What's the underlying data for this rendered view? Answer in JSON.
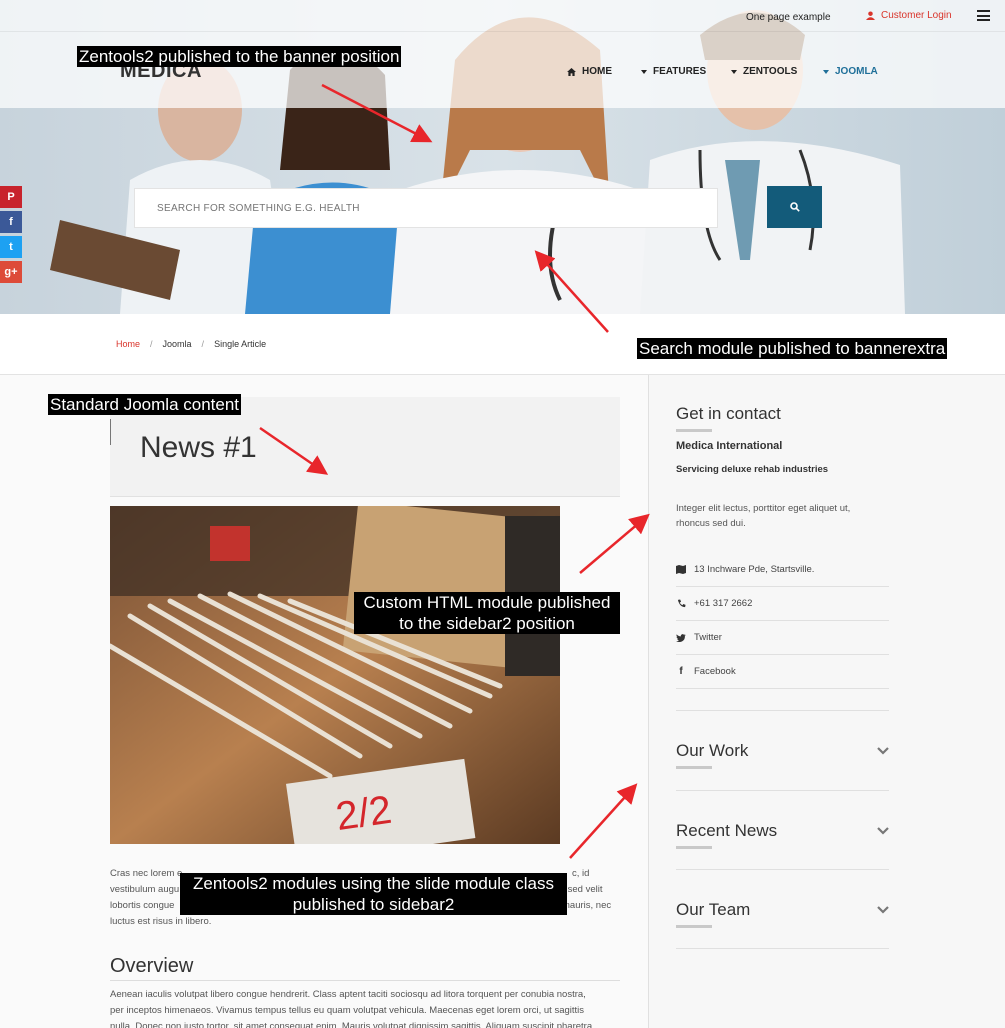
{
  "topbar": {
    "one_page": "One page example",
    "login": "Customer Login"
  },
  "logo": {
    "text": "MEDICA"
  },
  "nav": [
    {
      "label": "HOME",
      "icon": "home-icon"
    },
    {
      "label": "FEATURES",
      "icon": "caret-icon"
    },
    {
      "label": "ZENTOOLS",
      "icon": "caret-icon"
    },
    {
      "label": "JOOMLA",
      "icon": "caret-icon",
      "active": true
    }
  ],
  "search": {
    "placeholder": "SEARCH FOR SOMETHING E.G. HEALTH"
  },
  "social": [
    "pinterest-icon",
    "facebook-icon",
    "twitter-icon",
    "google-plus-icon"
  ],
  "breadcrumb": {
    "home": "Home",
    "joomla": "Joomla",
    "current": "Single Article"
  },
  "article": {
    "title": "News #1",
    "para1": [
      "Cras nec lorem e",
      "vestibulum augu",
      "lobortis congue",
      "luctus est risus in libero."
    ],
    "para1_right": [
      "c, id",
      "isi sed velit",
      "mauris, nec"
    ],
    "overview": "Overview",
    "para2": [
      "Aenean iaculis volutpat libero congue hendrerit. Class aptent taciti sociosqu ad litora torquent per conubia nostra,",
      "per inceptos himenaeos. Vivamus tempus tellus eu quam volutpat vehicula. Maecenas eget lorem orci, ut sagittis",
      "nulla. Donec non justo tortor, sit amet consequat enim. Mauris volutpat dignissim sagittis. Aliquam suscipit pharetra"
    ]
  },
  "sidebar": {
    "contact_title": "Get in contact",
    "org": "Medica International",
    "tagline": "Servicing deluxe rehab industries",
    "text": "Integer elit lectus, porttitor eget aliquet ut, rhoncus sed dui.",
    "items": [
      {
        "icon": "map-icon",
        "label": "13 Inchware Pde, Startsville."
      },
      {
        "icon": "phone-icon",
        "label": "+61 317 2662"
      },
      {
        "icon": "twitter-icon",
        "label": "Twitter"
      },
      {
        "icon": "facebook-icon",
        "label": "Facebook"
      }
    ],
    "work": "Our Work",
    "news": "Recent News",
    "team": "Our Team"
  },
  "annotations": {
    "banner": "Zentools2 published to the banner position",
    "search": "Search module published to bannerextra",
    "content": "Standard Joomla content",
    "custom_1": "Custom HTML module published",
    "custom_2": "to the sidebar2 position",
    "slide_1": "Zentools2 modules using the slide module class",
    "slide_2": "published to sidebar2"
  },
  "colors": {
    "accent_red": "#d9342b",
    "search_button": "#135b7a",
    "active_nav": "#1f6f99",
    "annotation_arrow": "#e8262b"
  }
}
